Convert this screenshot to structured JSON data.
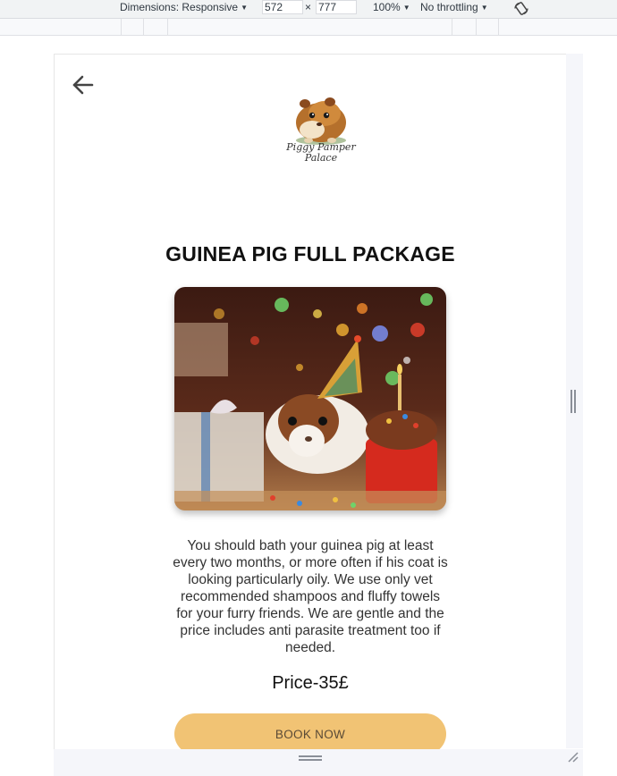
{
  "devtools": {
    "dimensions_label": "Dimensions: Responsive",
    "width_value": "572",
    "times_sign": "×",
    "height_value": "777",
    "zoom": "100%",
    "throttling": "No throttling"
  },
  "page": {
    "logo_text_line1": "Piggy Pamper",
    "logo_text_line2": "Palace",
    "title": "GUINEA PIG FULL PACKAGE",
    "description": "You should bath your guinea pig at least every two months, or more often if his coat is looking particularly oily. We use only vet recommended shampoos and fluffy towels for your furry friends. We are gentle and the price includes anti parasite treatment too if needed.",
    "price": "Price-35£",
    "book_button": "BOOK NOW"
  },
  "colors": {
    "button": "#f1c374",
    "button_text": "#5a4a36",
    "title": "#111111"
  },
  "icons": {
    "back": "arrow-left-icon",
    "rotate": "rotate-device-icon"
  }
}
